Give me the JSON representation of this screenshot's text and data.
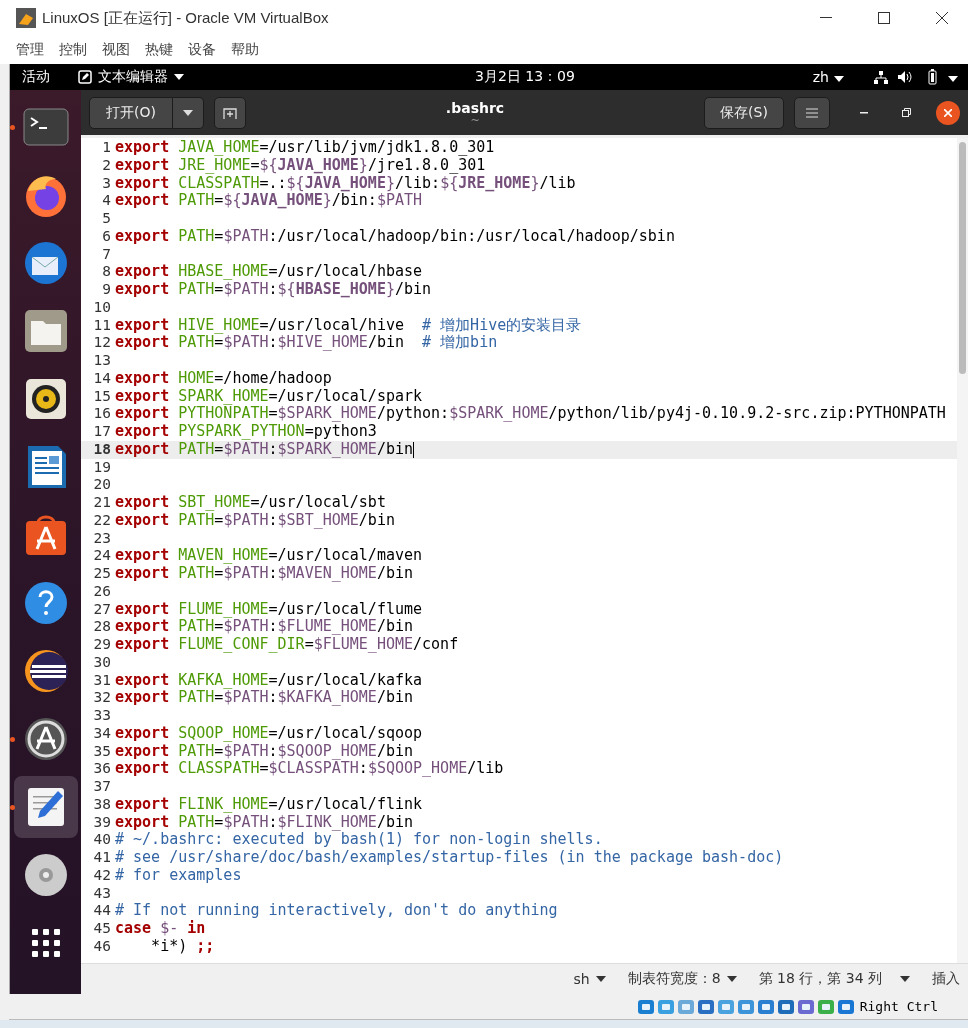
{
  "window": {
    "title": "LinuxOS [正在运行] - Oracle VM VirtualBox"
  },
  "menu": [
    "管理",
    "控制",
    "视图",
    "热键",
    "设备",
    "帮助"
  ],
  "top_bar": {
    "activities": "活动",
    "app_name": "文本编辑器",
    "clock": "3月2日 13：09",
    "input_method": "zh"
  },
  "dock": [
    {
      "kind": "terminal",
      "running": true,
      "selected": false
    },
    {
      "kind": "browser",
      "running": false,
      "selected": false
    },
    {
      "kind": "mail",
      "running": false,
      "selected": false
    },
    {
      "kind": "files",
      "running": false,
      "selected": false
    },
    {
      "kind": "music",
      "running": false,
      "selected": false
    },
    {
      "kind": "document",
      "running": false,
      "selected": false
    },
    {
      "kind": "store",
      "running": false,
      "selected": false
    },
    {
      "kind": "help",
      "running": false,
      "selected": false
    },
    {
      "kind": "ide",
      "running": false,
      "selected": false
    },
    {
      "kind": "updater",
      "running": true,
      "selected": false
    },
    {
      "kind": "editor",
      "running": true,
      "selected": true
    },
    {
      "kind": "disc",
      "running": false,
      "selected": false
    },
    {
      "kind": "apps",
      "running": false,
      "selected": false
    }
  ],
  "header": {
    "open_button": "打开(O)",
    "title": ".bashrc",
    "subtitle": "~",
    "save_button": "保存(S)"
  },
  "lines": [
    {
      "number": "1",
      "current": false,
      "tokens": [
        {
          "kind": "kw",
          "text": "export "
        },
        {
          "kind": "name",
          "text": "JAVA_HOME"
        },
        {
          "kind": "plain",
          "text": "=/usr/lib/jvm/jdk1.8.0_301"
        }
      ]
    },
    {
      "number": "2",
      "current": false,
      "tokens": [
        {
          "kind": "kw",
          "text": "export "
        },
        {
          "kind": "name",
          "text": "JRE_HOME"
        },
        {
          "kind": "plain",
          "text": "="
        },
        {
          "kind": "ref",
          "text": "${"
        },
        {
          "kind": "refb",
          "text": "JAVA_HOME"
        },
        {
          "kind": "ref",
          "text": "}"
        },
        {
          "kind": "plain",
          "text": "/jre1.8.0_301"
        }
      ]
    },
    {
      "number": "3",
      "current": false,
      "tokens": [
        {
          "kind": "kw",
          "text": "export "
        },
        {
          "kind": "name",
          "text": "CLASSPATH"
        },
        {
          "kind": "plain",
          "text": "=.:"
        },
        {
          "kind": "ref",
          "text": "${"
        },
        {
          "kind": "refb",
          "text": "JAVA_HOME"
        },
        {
          "kind": "ref",
          "text": "}"
        },
        {
          "kind": "plain",
          "text": "/lib:"
        },
        {
          "kind": "ref",
          "text": "${"
        },
        {
          "kind": "refb",
          "text": "JRE_HOME"
        },
        {
          "kind": "ref",
          "text": "}"
        },
        {
          "kind": "plain",
          "text": "/lib"
        }
      ]
    },
    {
      "number": "4",
      "current": false,
      "tokens": [
        {
          "kind": "kw",
          "text": "export "
        },
        {
          "kind": "name",
          "text": "PATH"
        },
        {
          "kind": "plain",
          "text": "="
        },
        {
          "kind": "ref",
          "text": "${"
        },
        {
          "kind": "refb",
          "text": "JAVA_HOME"
        },
        {
          "kind": "ref",
          "text": "}"
        },
        {
          "kind": "plain",
          "text": "/bin:"
        },
        {
          "kind": "ref",
          "text": "$PATH"
        }
      ]
    },
    {
      "number": "5",
      "current": false
    },
    {
      "number": "6",
      "current": false,
      "tokens": [
        {
          "kind": "kw",
          "text": "export "
        },
        {
          "kind": "name",
          "text": "PATH"
        },
        {
          "kind": "plain",
          "text": "="
        },
        {
          "kind": "ref",
          "text": "$PATH"
        },
        {
          "kind": "plain",
          "text": ":/usr/local/hadoop/bin:/usr/local/hadoop/sbin"
        }
      ]
    },
    {
      "number": "7",
      "current": false
    },
    {
      "number": "8",
      "current": false,
      "tokens": [
        {
          "kind": "kw",
          "text": "export "
        },
        {
          "kind": "name",
          "text": "HBASE_HOME"
        },
        {
          "kind": "plain",
          "text": "=/usr/local/hbase"
        }
      ]
    },
    {
      "number": "9",
      "current": false,
      "tokens": [
        {
          "kind": "kw",
          "text": "export "
        },
        {
          "kind": "name",
          "text": "PATH"
        },
        {
          "kind": "plain",
          "text": "="
        },
        {
          "kind": "ref",
          "text": "$PATH"
        },
        {
          "kind": "plain",
          "text": ":"
        },
        {
          "kind": "ref",
          "text": "${"
        },
        {
          "kind": "refb",
          "text": "HBASE_HOME"
        },
        {
          "kind": "ref",
          "text": "}"
        },
        {
          "kind": "plain",
          "text": "/bin"
        }
      ]
    },
    {
      "number": "10",
      "current": false
    },
    {
      "number": "11",
      "current": false,
      "tokens": [
        {
          "kind": "kw",
          "text": "export "
        },
        {
          "kind": "name",
          "text": "HIVE_HOME"
        },
        {
          "kind": "plain",
          "text": "=/usr/local/hive  "
        },
        {
          "kind": "comment",
          "text": "# 增加Hive的安装目录"
        }
      ]
    },
    {
      "number": "12",
      "current": false,
      "tokens": [
        {
          "kind": "kw",
          "text": "export "
        },
        {
          "kind": "name",
          "text": "PATH"
        },
        {
          "kind": "plain",
          "text": "="
        },
        {
          "kind": "ref",
          "text": "$PATH"
        },
        {
          "kind": "plain",
          "text": ":"
        },
        {
          "kind": "ref",
          "text": "$HIVE_HOME"
        },
        {
          "kind": "plain",
          "text": "/bin  "
        },
        {
          "kind": "comment",
          "text": "# 增加bin"
        }
      ]
    },
    {
      "number": "13",
      "current": false
    },
    {
      "number": "14",
      "current": false,
      "tokens": [
        {
          "kind": "kw",
          "text": "export "
        },
        {
          "kind": "name",
          "text": "HOME"
        },
        {
          "kind": "plain",
          "text": "=/home/hadoop"
        }
      ]
    },
    {
      "number": "15",
      "current": false,
      "tokens": [
        {
          "kind": "kw",
          "text": "export "
        },
        {
          "kind": "name",
          "text": "SPARK_HOME"
        },
        {
          "kind": "plain",
          "text": "=/usr/local/spark"
        }
      ]
    },
    {
      "number": "16",
      "current": false,
      "tokens": [
        {
          "kind": "kw",
          "text": "export "
        },
        {
          "kind": "name",
          "text": "PYTHONPATH"
        },
        {
          "kind": "plain",
          "text": "="
        },
        {
          "kind": "ref",
          "text": "$SPARK_HOME"
        },
        {
          "kind": "plain",
          "text": "/python:"
        },
        {
          "kind": "ref",
          "text": "$SPARK_HOME"
        },
        {
          "kind": "plain",
          "text": "/python/lib/py4j-0.10.9.2-src.zip:PYTHONPATH"
        }
      ]
    },
    {
      "number": "17",
      "current": false,
      "tokens": [
        {
          "kind": "kw",
          "text": "export "
        },
        {
          "kind": "name",
          "text": "PYSPARK_PYTHON"
        },
        {
          "kind": "plain",
          "text": "=python3"
        }
      ]
    },
    {
      "number": "18",
      "current": true,
      "tokens": [
        {
          "kind": "kw",
          "text": "export "
        },
        {
          "kind": "name",
          "text": "PATH"
        },
        {
          "kind": "plain",
          "text": "="
        },
        {
          "kind": "ref",
          "text": "$PATH"
        },
        {
          "kind": "plain",
          "text": ":"
        },
        {
          "kind": "ref",
          "text": "$SPARK_HOME"
        },
        {
          "kind": "plain",
          "text": "/bin"
        }
      ]
    },
    {
      "number": "19",
      "current": false
    },
    {
      "number": "20",
      "current": false
    },
    {
      "number": "21",
      "current": false,
      "tokens": [
        {
          "kind": "kw",
          "text": "export "
        },
        {
          "kind": "name",
          "text": "SBT_HOME"
        },
        {
          "kind": "plain",
          "text": "=/usr/local/sbt"
        }
      ]
    },
    {
      "number": "22",
      "current": false,
      "tokens": [
        {
          "kind": "kw",
          "text": "export "
        },
        {
          "kind": "name",
          "text": "PATH"
        },
        {
          "kind": "plain",
          "text": "="
        },
        {
          "kind": "ref",
          "text": "$PATH"
        },
        {
          "kind": "plain",
          "text": ":"
        },
        {
          "kind": "ref",
          "text": "$SBT_HOME"
        },
        {
          "kind": "plain",
          "text": "/bin"
        }
      ]
    },
    {
      "number": "23",
      "current": false
    },
    {
      "number": "24",
      "current": false,
      "tokens": [
        {
          "kind": "kw",
          "text": "export "
        },
        {
          "kind": "name",
          "text": "MAVEN_HOME"
        },
        {
          "kind": "plain",
          "text": "=/usr/local/maven"
        }
      ]
    },
    {
      "number": "25",
      "current": false,
      "tokens": [
        {
          "kind": "kw",
          "text": "export "
        },
        {
          "kind": "name",
          "text": "PATH"
        },
        {
          "kind": "plain",
          "text": "="
        },
        {
          "kind": "ref",
          "text": "$PATH"
        },
        {
          "kind": "plain",
          "text": ":"
        },
        {
          "kind": "ref",
          "text": "$MAVEN_HOME"
        },
        {
          "kind": "plain",
          "text": "/bin"
        }
      ]
    },
    {
      "number": "26",
      "current": false
    },
    {
      "number": "27",
      "current": false,
      "tokens": [
        {
          "kind": "kw",
          "text": "export "
        },
        {
          "kind": "name",
          "text": "FLUME_HOME"
        },
        {
          "kind": "plain",
          "text": "=/usr/local/flume"
        }
      ]
    },
    {
      "number": "28",
      "current": false,
      "tokens": [
        {
          "kind": "kw",
          "text": "export "
        },
        {
          "kind": "name",
          "text": "PATH"
        },
        {
          "kind": "plain",
          "text": "="
        },
        {
          "kind": "ref",
          "text": "$PATH"
        },
        {
          "kind": "plain",
          "text": ":"
        },
        {
          "kind": "ref",
          "text": "$FLUME_HOME"
        },
        {
          "kind": "plain",
          "text": "/bin"
        }
      ]
    },
    {
      "number": "29",
      "current": false,
      "tokens": [
        {
          "kind": "kw",
          "text": "export "
        },
        {
          "kind": "name",
          "text": "FLUME_CONF_DIR"
        },
        {
          "kind": "plain",
          "text": "="
        },
        {
          "kind": "ref",
          "text": "$FLUME_HOME"
        },
        {
          "kind": "plain",
          "text": "/conf"
        }
      ]
    },
    {
      "number": "30",
      "current": false
    },
    {
      "number": "31",
      "current": false,
      "tokens": [
        {
          "kind": "kw",
          "text": "export "
        },
        {
          "kind": "name",
          "text": "KAFKA_HOME"
        },
        {
          "kind": "plain",
          "text": "=/usr/local/kafka"
        }
      ]
    },
    {
      "number": "32",
      "current": false,
      "tokens": [
        {
          "kind": "kw",
          "text": "export "
        },
        {
          "kind": "name",
          "text": "PATH"
        },
        {
          "kind": "plain",
          "text": "="
        },
        {
          "kind": "ref",
          "text": "$PATH"
        },
        {
          "kind": "plain",
          "text": ":"
        },
        {
          "kind": "ref",
          "text": "$KAFKA_HOME"
        },
        {
          "kind": "plain",
          "text": "/bin"
        }
      ]
    },
    {
      "number": "33",
      "current": false
    },
    {
      "number": "34",
      "current": false,
      "tokens": [
        {
          "kind": "kw",
          "text": "export "
        },
        {
          "kind": "name",
          "text": "SQOOP_HOME"
        },
        {
          "kind": "plain",
          "text": "=/usr/local/sqoop"
        }
      ]
    },
    {
      "number": "35",
      "current": false,
      "tokens": [
        {
          "kind": "kw",
          "text": "export "
        },
        {
          "kind": "name",
          "text": "PATH"
        },
        {
          "kind": "plain",
          "text": "="
        },
        {
          "kind": "ref",
          "text": "$PATH"
        },
        {
          "kind": "plain",
          "text": ":"
        },
        {
          "kind": "ref",
          "text": "$SQOOP_HOME"
        },
        {
          "kind": "plain",
          "text": "/bin"
        }
      ]
    },
    {
      "number": "36",
      "current": false,
      "tokens": [
        {
          "kind": "kw",
          "text": "export "
        },
        {
          "kind": "name",
          "text": "CLASSPATH"
        },
        {
          "kind": "plain",
          "text": "="
        },
        {
          "kind": "ref",
          "text": "$CLASSPATH"
        },
        {
          "kind": "plain",
          "text": ":"
        },
        {
          "kind": "ref",
          "text": "$SQOOP_HOME"
        },
        {
          "kind": "plain",
          "text": "/lib"
        }
      ]
    },
    {
      "number": "37",
      "current": false
    },
    {
      "number": "38",
      "current": false,
      "tokens": [
        {
          "kind": "kw",
          "text": "export "
        },
        {
          "kind": "name",
          "text": "FLINK_HOME"
        },
        {
          "kind": "plain",
          "text": "=/usr/local/flink"
        }
      ]
    },
    {
      "number": "39",
      "current": false,
      "tokens": [
        {
          "kind": "kw",
          "text": "export "
        },
        {
          "kind": "name",
          "text": "PATH"
        },
        {
          "kind": "plain",
          "text": "="
        },
        {
          "kind": "ref",
          "text": "$PATH"
        },
        {
          "kind": "plain",
          "text": ":"
        },
        {
          "kind": "ref",
          "text": "$FLINK_HOME"
        },
        {
          "kind": "plain",
          "text": "/bin"
        }
      ]
    },
    {
      "number": "40",
      "current": false,
      "tokens": [
        {
          "kind": "comment",
          "text": "# ~/.bashrc: executed by bash(1) for non-login shells."
        }
      ]
    },
    {
      "number": "41",
      "current": false,
      "tokens": [
        {
          "kind": "comment",
          "text": "# see /usr/share/doc/bash/examples/startup-files (in the package bash-doc)"
        }
      ]
    },
    {
      "number": "42",
      "current": false,
      "tokens": [
        {
          "kind": "comment",
          "text": "# for examples"
        }
      ]
    },
    {
      "number": "43",
      "current": false
    },
    {
      "number": "44",
      "current": false,
      "tokens": [
        {
          "kind": "comment",
          "text": "# If not running interactively, don't do anything"
        }
      ]
    },
    {
      "number": "45",
      "current": false,
      "tokens": [
        {
          "kind": "kw",
          "text": "case "
        },
        {
          "kind": "ref",
          "text": "$- "
        },
        {
          "kind": "kw",
          "text": "in"
        }
      ]
    },
    {
      "number": "46",
      "current": false,
      "tokens": [
        {
          "kind": "plain",
          "text": "    *i*) "
        },
        {
          "kind": "kw",
          "text": ";;"
        }
      ]
    }
  ],
  "status_bar": {
    "language": "sh",
    "tab_width": "制表符宽度：8",
    "position": "第 18 行，第 34 列",
    "mode": "插入"
  },
  "vbox_status": {
    "host_key": "Right Ctrl"
  }
}
